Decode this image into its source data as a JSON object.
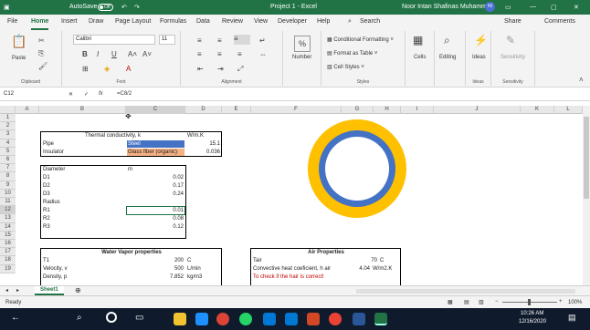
{
  "titlebar": {
    "autosave": "AutoSave",
    "autosave_state": "Off",
    "title": "Project 1 - Excel",
    "user": "Noor Intan Shafinas Muhammad",
    "initials": "NI"
  },
  "tabs": [
    "File",
    "Home",
    "Insert",
    "Draw",
    "Page Layout",
    "Formulas",
    "Data",
    "Review",
    "View",
    "Developer",
    "Help"
  ],
  "search": "Search",
  "share": "Share",
  "comments": "Comments",
  "ribbon": {
    "paste": "Paste",
    "clipboard": "Clipboard",
    "font_name": "Calibri",
    "font_size": "11",
    "font": "Font",
    "alignment": "Alignment",
    "number": "Number",
    "number_sym": "%",
    "cond_format": "Conditional Formatting",
    "format_table": "Format as Table",
    "cell_styles": "Cell Styles",
    "styles": "Styles",
    "cells": "Cells",
    "editing": "Editing",
    "ideas": "Ideas",
    "sensitivity": "Sensitivity",
    "bold": "B",
    "italic": "I",
    "underline": "U"
  },
  "formula": {
    "namebox": "C12",
    "fx": "fx",
    "content": "=C8/2"
  },
  "columns": [
    "A",
    "B",
    "C",
    "D",
    "E",
    "F",
    "G",
    "H",
    "I",
    "J",
    "K",
    "L"
  ],
  "rows": [
    "1",
    "2",
    "3",
    "4",
    "5",
    "6",
    "7",
    "8",
    "9",
    "10",
    "11",
    "12",
    "13",
    "14",
    "15",
    "16",
    "17",
    "18",
    "19"
  ],
  "cells": {
    "b3": "Thermal conductivity, k",
    "d3": "W/m.K",
    "b4": "Pipe",
    "c4": "Steel",
    "d4": "15.1",
    "b5": "Insulator",
    "c5": "Glass fiber (organic)",
    "d5": "0.036",
    "b7": "Diameter",
    "c7": "m",
    "b8": "D1",
    "c8": "0.02",
    "b9": "D2",
    "c9": "0.17",
    "b10": "D3",
    "c10": "0.24",
    "b11": "Radius",
    "b12": "R1",
    "c12": "0.01",
    "b13": "R2",
    "c13": "0.08",
    "b14": "R3",
    "c14": "0.12",
    "b16": "Water Vapor properties",
    "b17": "T1",
    "c17": "200",
    "d17": "C",
    "b18": "Velocity, v",
    "c18": "500",
    "d18": "L/min",
    "b19": "Density, p",
    "c19": "7.852",
    "d19": "kg/m3",
    "f16": "Air Properties",
    "f17": "Tair",
    "h17": "70",
    "i17": "C",
    "f18": "Convective heat coeficient, h air",
    "h18": "4.04",
    "i18": "W/m2.K",
    "f19": "To check if the hair is correct!"
  },
  "colors": {
    "steel": "#4472c4",
    "glass": "#f4b183",
    "ring_outer": "#ffc000",
    "ring_inner": "#4472c4",
    "brand": "#217346"
  },
  "sheet": "Sheet1",
  "status": "Ready",
  "zoom": "100%",
  "taskbar": {
    "time": "10:26 AM",
    "date": "12/16/2020"
  }
}
